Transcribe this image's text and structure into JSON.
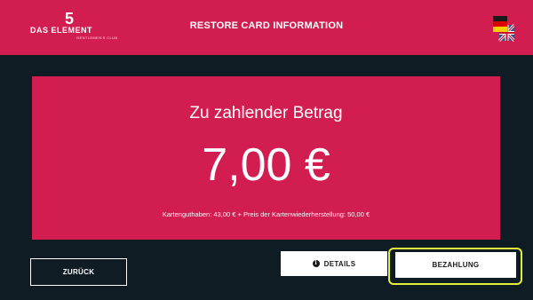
{
  "header": {
    "logo_number": "5",
    "logo_text": "DAS ELEMENT",
    "logo_sub": "GENTLEMEN'S CLUB",
    "title": "RESTORE CARD INFORMATION",
    "language_icon": "flag-de-uk-icon"
  },
  "amount": {
    "label": "Zu zahlender Betrag",
    "value": "7,00 €",
    "note": "Kartenguthaben: 43,00 € + Preis der Kartenwiederherstellung: 50,00 €"
  },
  "buttons": {
    "back": "ZURÜCK",
    "details": "DETAILS",
    "details_icon": "info-icon",
    "pay": "BEZAHLUNG"
  },
  "colors": {
    "accent": "#d21d50",
    "background": "#0f1c24",
    "focus": "#e4ef3a"
  }
}
